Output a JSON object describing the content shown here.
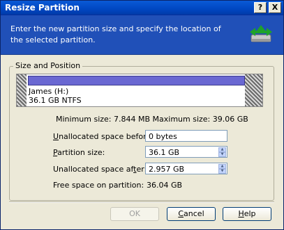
{
  "window": {
    "title": "Resize Partition",
    "help_button": "?",
    "close_button": "X"
  },
  "banner": {
    "message": "Enter the new partition size and specify the location of the selected partition."
  },
  "group": {
    "title": "Size and Position",
    "partition_name": "James (H:)",
    "partition_info": "36.1 GB  NTFS"
  },
  "limits": {
    "text": "Minimum size: 7.844 MB  Maximum size: 39.06 GB"
  },
  "fields": {
    "before": {
      "label_key": "U",
      "label_rest": "nallocated space before:",
      "value": "0 bytes"
    },
    "size": {
      "label_key": "P",
      "label_rest": "artition size:",
      "value": "36.1 GB"
    },
    "after_label_prefix": "Unallocated space af",
    "after_label_key": "t",
    "after_label_rest": "er:",
    "after_value": "2.957 GB"
  },
  "free_space": {
    "label": "Free space on partition:",
    "value": "36.04 GB"
  },
  "buttons": {
    "ok": "OK",
    "cancel_key": "C",
    "cancel_rest": "ancel",
    "help_key": "H",
    "help_rest": "elp"
  }
}
